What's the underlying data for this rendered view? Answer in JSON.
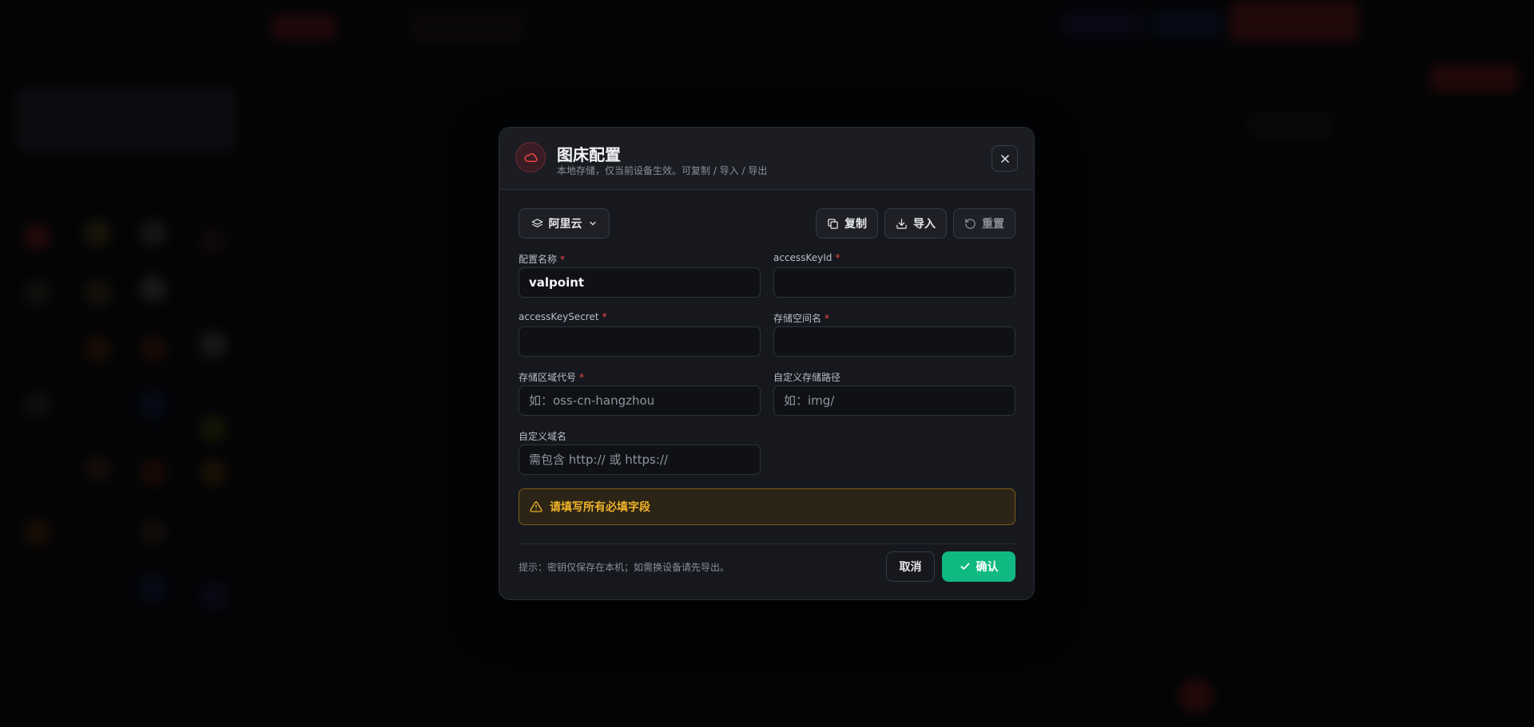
{
  "modal": {
    "title": "图床配置",
    "subtitle": "本地存储，仅当前设备生效。可复制 / 导入 / 导出",
    "close_icon": "close-icon",
    "header_icon": "cloud-icon"
  },
  "toolbar": {
    "provider_label": "阿里云",
    "copy_label": "复制",
    "import_label": "导入",
    "reset_label": "重置"
  },
  "form": {
    "required_mark": "*",
    "fields": [
      {
        "label": "配置名称",
        "required": true,
        "value": "valpoint",
        "placeholder": ""
      },
      {
        "label": "accessKeyId",
        "required": true,
        "value": "",
        "placeholder": ""
      },
      {
        "label": "accessKeySecret",
        "required": true,
        "value": "",
        "placeholder": ""
      },
      {
        "label": "存储空间名",
        "required": true,
        "value": "",
        "placeholder": ""
      },
      {
        "label": "存储区域代号",
        "required": true,
        "value": "",
        "placeholder": "如：oss-cn-hangzhou"
      },
      {
        "label": "自定义存储路径",
        "required": false,
        "value": "",
        "placeholder": "如：img/"
      },
      {
        "label": "自定义域名",
        "required": false,
        "value": "",
        "placeholder": "需包含 http:// 或 https://"
      }
    ]
  },
  "warning": {
    "text": "请填写所有必填字段",
    "color": "#f0b429"
  },
  "footer": {
    "hint": "提示：密钥仅保存在本机；如需换设备请先导出。",
    "cancel_label": "取消",
    "confirm_label": "确认"
  },
  "colors": {
    "accent": "#10b981",
    "brand_red": "#ef4444",
    "warning": "#f0b429"
  }
}
